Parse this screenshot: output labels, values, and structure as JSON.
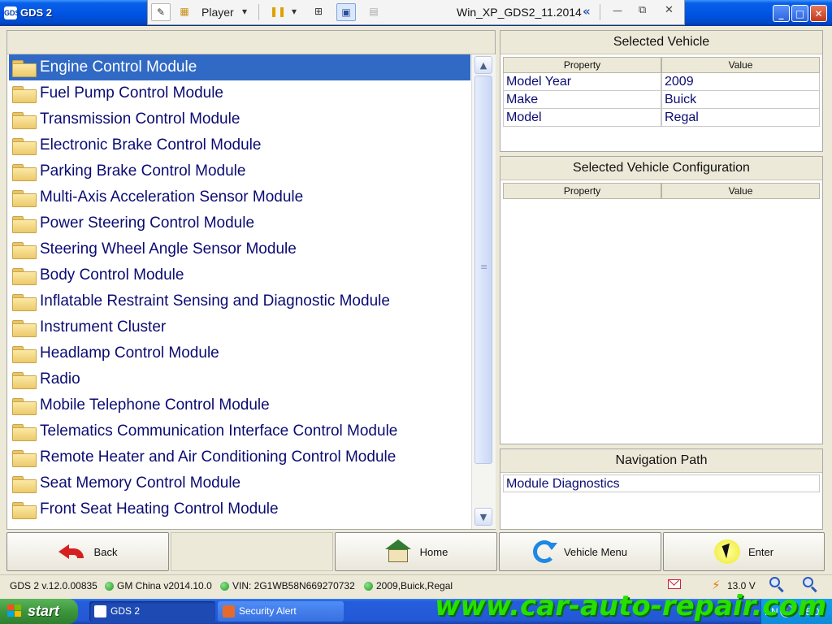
{
  "window": {
    "title": "GDS 2",
    "app_icon": "GDS",
    "minimize": "_",
    "maximize": "□",
    "close": "✕"
  },
  "player_toolbar": {
    "label": "Player",
    "dropdown": "▾",
    "vm_name": "Win_XP_GDS2_11.2014",
    "collapse": "«",
    "minimize": "—",
    "restore": "⧉",
    "close": "✕"
  },
  "module_list": {
    "selected_index": 0,
    "items": [
      "Engine Control Module",
      "Fuel Pump Control Module",
      "Transmission Control Module",
      "Electronic Brake Control Module",
      "Parking Brake Control Module",
      "Multi-Axis Acceleration Sensor Module",
      "Power Steering Control Module",
      "Steering Wheel Angle Sensor Module",
      "Body Control Module",
      "Inflatable Restraint Sensing and Diagnostic Module",
      "Instrument Cluster",
      "Headlamp Control Module",
      "Radio",
      "Mobile Telephone Control Module",
      "Telematics Communication Interface Control Module",
      "Remote Heater and Air Conditioning Control Module",
      "Seat Memory Control Module",
      "Front Seat Heating Control Module"
    ],
    "scroll_up": "▲",
    "scroll_down": "▼"
  },
  "selected_vehicle": {
    "title": "Selected Vehicle",
    "headers": {
      "property": "Property",
      "value": "Value"
    },
    "rows": [
      {
        "property": "Model Year",
        "value": "2009"
      },
      {
        "property": "Make",
        "value": "Buick"
      },
      {
        "property": "Model",
        "value": "Regal"
      }
    ]
  },
  "vehicle_configuration": {
    "title": "Selected Vehicle Configuration",
    "headers": {
      "property": "Property",
      "value": "Value"
    }
  },
  "navigation_path": {
    "title": "Navigation Path",
    "value": "Module Diagnostics"
  },
  "buttons": {
    "back": "Back",
    "home": "Home",
    "vehicle_menu": "Vehicle Menu",
    "enter": "Enter"
  },
  "status_bar": {
    "version": "GDS 2 v.12.0.00835",
    "database": "GM China v2014.10.0",
    "vin": "VIN: 2G1WB58N669270732",
    "vehicle": "2009,Buick,Regal",
    "voltage": "13.0 V"
  },
  "taskbar": {
    "start_label": "start",
    "tasks": [
      {
        "label": "GDS 2",
        "active": true
      },
      {
        "label": "Security Alert",
        "active": false
      }
    ],
    "language": "EN",
    "time": "15:05"
  },
  "watermark": "www.car-auto-repair.com",
  "colors": {
    "selection": "#316AC5",
    "item_text": "#0B0B73",
    "status_ok": "#1F9A1F",
    "xp_blue": "#0055E5",
    "watermark": "#26E000"
  }
}
